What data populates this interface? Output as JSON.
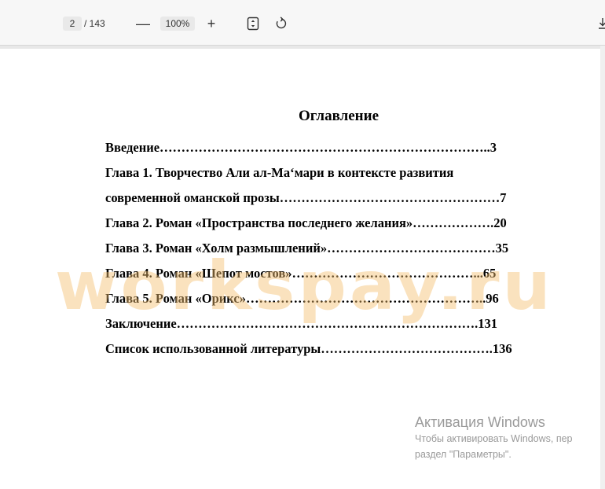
{
  "toolbar": {
    "page_current": "2",
    "page_total": "/ 143",
    "zoom_out_label": "—",
    "zoom_value": "100%",
    "zoom_in_label": "+",
    "fit_icon": "fit-page-icon",
    "rotate_icon": "rotate-icon",
    "download_icon": "download-icon"
  },
  "document": {
    "title": "Оглавление",
    "toc": [
      "Введение…………………………………………………………………..3",
      "Глава 1. Творчество Али ал-Ма‘мари в контексте развития",
      "современной оманской прозы……………………………………………7",
      "Глава 2. Роман «Пространства последнего желания»……………….20",
      "Глава 3. Роман «Холм размышлений»…………………………………35",
      "Глава 4. Роман «Шепот мостов»……………………………………...65",
      "Глава 5. Роман «Орикс»………………………………………………..96",
      "Заключение…………………………………………………………….131",
      "Список использованной литературы………………………………….136"
    ]
  },
  "watermark": "workspay.ru",
  "activation": {
    "title": "Активация Windows",
    "line1": "Чтобы активировать Windows, пер",
    "line2": "раздел \"Параметры\"."
  }
}
